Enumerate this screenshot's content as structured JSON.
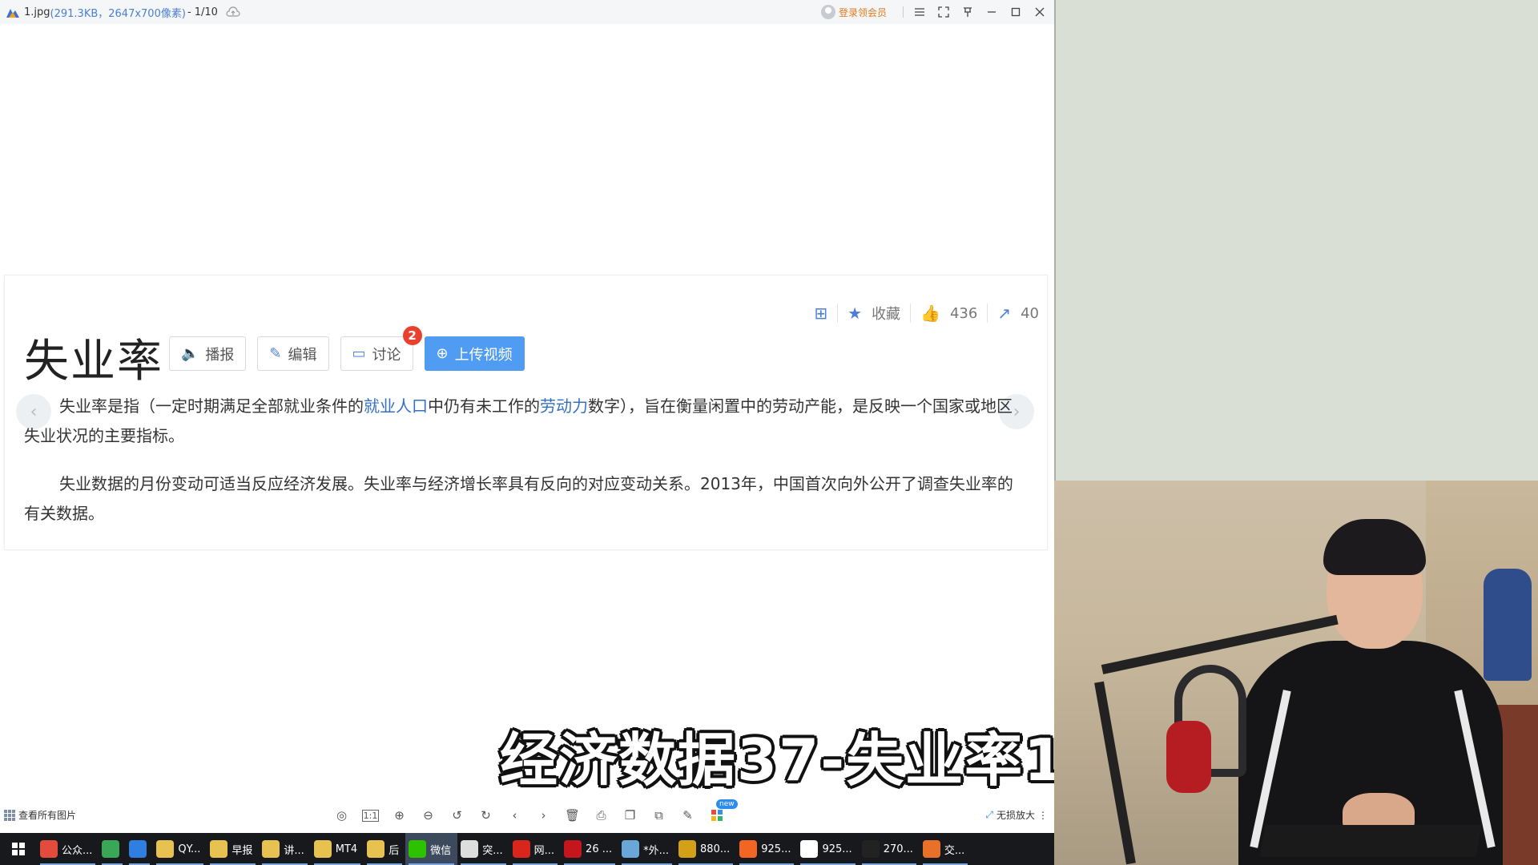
{
  "window": {
    "file_name": "1.jpg",
    "file_meta": "(291.3KB，2647x700像素)",
    "page_info": "- 1/10",
    "member_label": "登录领会员"
  },
  "image_content": {
    "title": "失业率",
    "actions": [
      {
        "label": "播报",
        "icon": "speaker-icon"
      },
      {
        "label": "编辑",
        "icon": "pencil-icon"
      },
      {
        "label": "讨论",
        "icon": "chat-icon",
        "badge": "2"
      },
      {
        "label": "上传视频",
        "icon": "plus-circle-icon"
      }
    ],
    "favorite_label": "收藏",
    "like_count": "436",
    "share_count": "40",
    "para1": {
      "p1": "失业率是指（一定时期满足全部就业条件的",
      "link1": "就业人口",
      "p2": "中仍有未工作的",
      "link2": "劳动力",
      "p3": "数字），旨在衡量闲置中的劳动产能，是反映一个国家或地区失业状况的主要指标。"
    },
    "para2": "失业数据的月份变动可适当反应经济发展。失业率与经济增长率具有反向的对应变动关系。2013年，中国首次向外公开了调查失业率的有关数据。"
  },
  "subtitle": "经济数据37-失业率1",
  "bottombar": {
    "view_all": "查看所有图片",
    "new_badge": "new",
    "lossless": "无损放大"
  },
  "taskbar": [
    {
      "label": "公众...",
      "color": "#e34c3c",
      "icon": "chrome-icon"
    },
    {
      "label": "",
      "color": "#3aa757",
      "icon": "app-green-icon"
    },
    {
      "label": "",
      "color": "#2f7fe0",
      "icon": "sogou-icon"
    },
    {
      "label": "QY...",
      "color": "#e8c250",
      "icon": "folder-icon"
    },
    {
      "label": "早报",
      "color": "#e8c250",
      "icon": "folder-icon"
    },
    {
      "label": "讲...",
      "color": "#e8c250",
      "icon": "folder-icon"
    },
    {
      "label": "MT4",
      "color": "#e8c250",
      "icon": "folder-icon"
    },
    {
      "label": "后",
      "color": "#e8c250",
      "icon": "folder-icon"
    },
    {
      "label": "微信",
      "color": "#2dc100",
      "icon": "wechat-icon",
      "active": true
    },
    {
      "label": "突...",
      "color": "#dddddd",
      "icon": "panda-icon"
    },
    {
      "label": "网...",
      "color": "#d8261d",
      "icon": "netease-icon"
    },
    {
      "label": "26 ...",
      "color": "#c4161c",
      "icon": "app-v-icon"
    },
    {
      "label": "*外...",
      "color": "#6aa7d9",
      "icon": "notepad-icon"
    },
    {
      "label": "880...",
      "color": "#d4a017",
      "icon": "app-a-icon"
    },
    {
      "label": "925...",
      "color": "#f26522",
      "icon": "app-orange-icon"
    },
    {
      "label": "925...",
      "color": "#ffffff",
      "icon": "app-x-icon"
    },
    {
      "label": "270...",
      "color": "#222222",
      "icon": "app-z-icon"
    },
    {
      "label": "交...",
      "color": "#e8712a",
      "icon": "chart-app-icon"
    }
  ]
}
